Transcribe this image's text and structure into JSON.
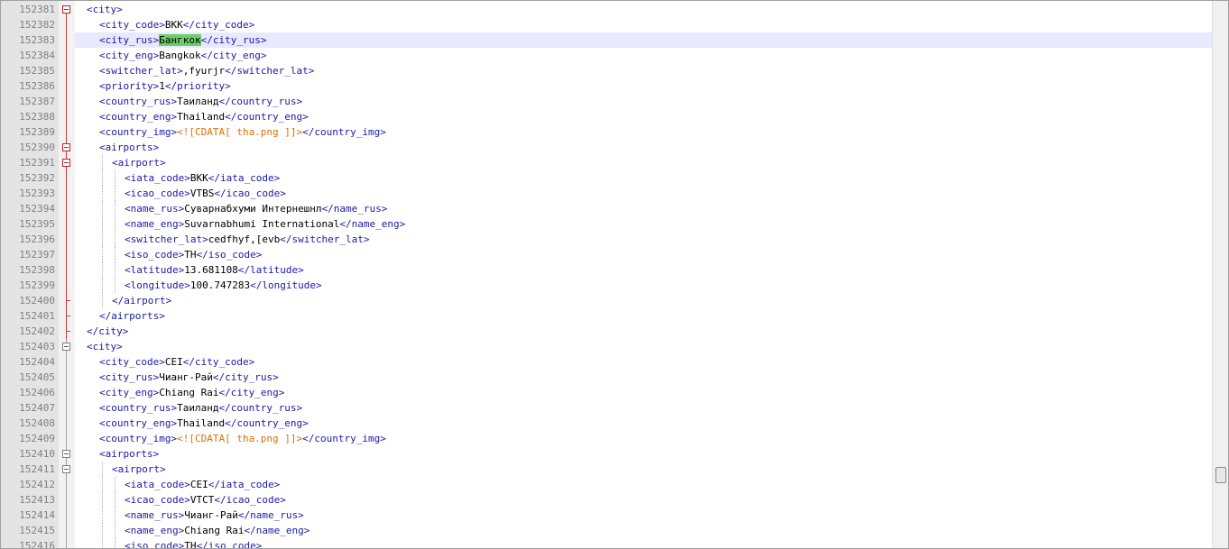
{
  "editor": {
    "current_line_index": 2,
    "lines": [
      {
        "num": "152381",
        "indent": 1,
        "fold": "open",
        "parts": [
          [
            "tag",
            "<city>"
          ]
        ]
      },
      {
        "num": "152382",
        "indent": 2,
        "fold": "line",
        "parts": [
          [
            "tag",
            "<city_code>"
          ],
          [
            "val",
            "BKK"
          ],
          [
            "tag",
            "</city_code>"
          ]
        ]
      },
      {
        "num": "152383",
        "indent": 2,
        "fold": "line",
        "parts": [
          [
            "tag",
            "<city_rus>"
          ],
          [
            "hl",
            "Бангкок"
          ],
          [
            "tag",
            "</city_rus>"
          ]
        ]
      },
      {
        "num": "152384",
        "indent": 2,
        "fold": "line",
        "parts": [
          [
            "tag",
            "<city_eng>"
          ],
          [
            "val",
            "Bangkok"
          ],
          [
            "tag",
            "</city_eng>"
          ]
        ]
      },
      {
        "num": "152385",
        "indent": 2,
        "fold": "line",
        "parts": [
          [
            "tag",
            "<switcher_lat>"
          ],
          [
            "val",
            ",fyurjr"
          ],
          [
            "tag",
            "</switcher_lat>"
          ]
        ]
      },
      {
        "num": "152386",
        "indent": 2,
        "fold": "line",
        "parts": [
          [
            "tag",
            "<priority>"
          ],
          [
            "val",
            "1"
          ],
          [
            "tag",
            "</priority>"
          ]
        ]
      },
      {
        "num": "152387",
        "indent": 2,
        "fold": "line",
        "parts": [
          [
            "tag",
            "<country_rus>"
          ],
          [
            "val",
            "Таиланд"
          ],
          [
            "tag",
            "</country_rus>"
          ]
        ]
      },
      {
        "num": "152388",
        "indent": 2,
        "fold": "line",
        "parts": [
          [
            "tag",
            "<country_eng>"
          ],
          [
            "val",
            "Thailand"
          ],
          [
            "tag",
            "</country_eng>"
          ]
        ]
      },
      {
        "num": "152389",
        "indent": 2,
        "fold": "line",
        "parts": [
          [
            "tag",
            "<country_img>"
          ],
          [
            "cdata",
            "<![CDATA[ tha.png ]]>"
          ],
          [
            "tag",
            "</country_img>"
          ]
        ]
      },
      {
        "num": "152390",
        "indent": 2,
        "fold": "open",
        "parts": [
          [
            "tag",
            "<airports>"
          ]
        ]
      },
      {
        "num": "152391",
        "indent": 3,
        "fold": "open",
        "parts": [
          [
            "tag",
            "<airport>"
          ]
        ]
      },
      {
        "num": "152392",
        "indent": 4,
        "fold": "line",
        "parts": [
          [
            "tag",
            "<iata_code>"
          ],
          [
            "val",
            "BKK"
          ],
          [
            "tag",
            "</iata_code>"
          ]
        ]
      },
      {
        "num": "152393",
        "indent": 4,
        "fold": "line",
        "parts": [
          [
            "tag",
            "<icao_code>"
          ],
          [
            "val",
            "VTBS"
          ],
          [
            "tag",
            "</icao_code>"
          ]
        ]
      },
      {
        "num": "152394",
        "indent": 4,
        "fold": "line",
        "parts": [
          [
            "tag",
            "<name_rus>"
          ],
          [
            "val",
            "Суварнабхуми Интернешнл"
          ],
          [
            "tag",
            "</name_rus>"
          ]
        ]
      },
      {
        "num": "152395",
        "indent": 4,
        "fold": "line",
        "parts": [
          [
            "tag",
            "<name_eng>"
          ],
          [
            "val",
            "Suvarnabhumi International"
          ],
          [
            "tag",
            "</name_eng>"
          ]
        ]
      },
      {
        "num": "152396",
        "indent": 4,
        "fold": "line",
        "parts": [
          [
            "tag",
            "<switcher_lat>"
          ],
          [
            "val",
            "cedfhyf,[evb"
          ],
          [
            "tag",
            "</switcher_lat>"
          ]
        ]
      },
      {
        "num": "152397",
        "indent": 4,
        "fold": "line",
        "parts": [
          [
            "tag",
            "<iso_code>"
          ],
          [
            "val",
            "TH"
          ],
          [
            "tag",
            "</iso_code>"
          ]
        ]
      },
      {
        "num": "152398",
        "indent": 4,
        "fold": "line",
        "parts": [
          [
            "tag",
            "<latitude>"
          ],
          [
            "val",
            "13.681108"
          ],
          [
            "tag",
            "</latitude>"
          ]
        ]
      },
      {
        "num": "152399",
        "indent": 4,
        "fold": "line",
        "parts": [
          [
            "tag",
            "<longitude>"
          ],
          [
            "val",
            "100.747283"
          ],
          [
            "tag",
            "</longitude>"
          ]
        ]
      },
      {
        "num": "152400",
        "indent": 3,
        "fold": "end",
        "parts": [
          [
            "tag",
            "</airport>"
          ]
        ]
      },
      {
        "num": "152401",
        "indent": 2,
        "fold": "end",
        "parts": [
          [
            "tag",
            "</airports>"
          ]
        ]
      },
      {
        "num": "152402",
        "indent": 1,
        "fold": "end",
        "parts": [
          [
            "tag",
            "</city>"
          ]
        ]
      },
      {
        "num": "152403",
        "indent": 1,
        "fold": "open-grey",
        "parts": [
          [
            "tag",
            "<city>"
          ]
        ]
      },
      {
        "num": "152404",
        "indent": 2,
        "fold": "line-grey",
        "parts": [
          [
            "tag",
            "<city_code>"
          ],
          [
            "val",
            "CEI"
          ],
          [
            "tag",
            "</city_code>"
          ]
        ]
      },
      {
        "num": "152405",
        "indent": 2,
        "fold": "line-grey",
        "parts": [
          [
            "tag",
            "<city_rus>"
          ],
          [
            "val",
            "Чианг-Рай"
          ],
          [
            "tag",
            "</city_rus>"
          ]
        ]
      },
      {
        "num": "152406",
        "indent": 2,
        "fold": "line-grey",
        "parts": [
          [
            "tag",
            "<city_eng>"
          ],
          [
            "val",
            "Chiang Rai"
          ],
          [
            "tag",
            "</city_eng>"
          ]
        ]
      },
      {
        "num": "152407",
        "indent": 2,
        "fold": "line-grey",
        "parts": [
          [
            "tag",
            "<country_rus>"
          ],
          [
            "val",
            "Таиланд"
          ],
          [
            "tag",
            "</country_rus>"
          ]
        ]
      },
      {
        "num": "152408",
        "indent": 2,
        "fold": "line-grey",
        "parts": [
          [
            "tag",
            "<country_eng>"
          ],
          [
            "val",
            "Thailand"
          ],
          [
            "tag",
            "</country_eng>"
          ]
        ]
      },
      {
        "num": "152409",
        "indent": 2,
        "fold": "line-grey",
        "parts": [
          [
            "tag",
            "<country_img>"
          ],
          [
            "cdata",
            "<![CDATA[ tha.png ]]>"
          ],
          [
            "tag",
            "</country_img>"
          ]
        ]
      },
      {
        "num": "152410",
        "indent": 2,
        "fold": "open-grey",
        "parts": [
          [
            "tag",
            "<airports>"
          ]
        ]
      },
      {
        "num": "152411",
        "indent": 3,
        "fold": "open-grey",
        "parts": [
          [
            "tag",
            "<airport>"
          ]
        ]
      },
      {
        "num": "152412",
        "indent": 4,
        "fold": "line-grey",
        "parts": [
          [
            "tag",
            "<iata_code>"
          ],
          [
            "val",
            "CEI"
          ],
          [
            "tag",
            "</iata_code>"
          ]
        ]
      },
      {
        "num": "152413",
        "indent": 4,
        "fold": "line-grey",
        "parts": [
          [
            "tag",
            "<icao_code>"
          ],
          [
            "val",
            "VTCT"
          ],
          [
            "tag",
            "</icao_code>"
          ]
        ]
      },
      {
        "num": "152414",
        "indent": 4,
        "fold": "line-grey",
        "parts": [
          [
            "tag",
            "<name_rus>"
          ],
          [
            "val",
            "Чианг-Рай"
          ],
          [
            "tag",
            "</name_rus>"
          ]
        ]
      },
      {
        "num": "152415",
        "indent": 4,
        "fold": "line-grey",
        "parts": [
          [
            "tag",
            "<name_eng>"
          ],
          [
            "val",
            "Chiang Rai"
          ],
          [
            "tag",
            "</name_eng>"
          ]
        ]
      },
      {
        "num": "152416",
        "indent": 4,
        "fold": "line-grey",
        "parts": [
          [
            "tag",
            "<iso_code>"
          ],
          [
            "val",
            "TH"
          ],
          [
            "tag",
            "</iso_code>"
          ]
        ]
      }
    ]
  },
  "colors": {
    "tag": "#1a1aa6",
    "cdata": "#e07000",
    "highlight": "#6ecf68",
    "current_line": "#e8e8ff",
    "fold_marker": "#d23a3a"
  }
}
